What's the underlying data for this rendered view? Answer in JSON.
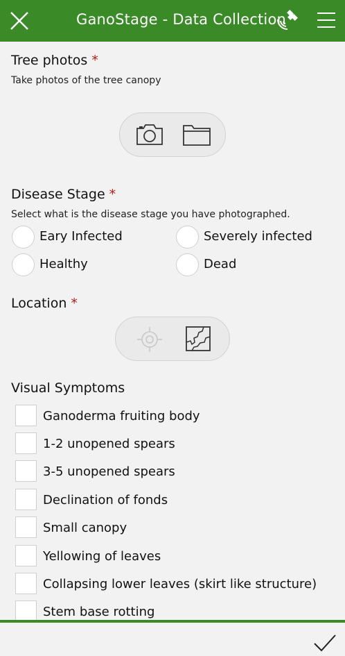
{
  "header": {
    "title": "GanoStage - Data Collection",
    "close_icon": "close-icon",
    "gps_icon": "satellite-icon",
    "menu_icon": "hamburger-menu-icon",
    "background_color": "#3a8a28"
  },
  "tree_photos": {
    "label": "Tree photos",
    "required_marker": "*",
    "hint": "Take photos of the tree canopy",
    "camera_icon": "camera-icon",
    "folder_icon": "folder-icon"
  },
  "disease_stage": {
    "label": "Disease Stage",
    "required_marker": "*",
    "hint": "Select what is the disease stage you have photographed.",
    "options": [
      {
        "label": "Eary Infected",
        "selected": false
      },
      {
        "label": "Severely infected",
        "selected": false
      },
      {
        "label": "Healthy",
        "selected": false
      },
      {
        "label": "Dead",
        "selected": false
      }
    ]
  },
  "location": {
    "label": "Location",
    "required_marker": "*",
    "gps_locate_icon": "crosshair-icon",
    "map_icon": "map-icon"
  },
  "visual_symptoms": {
    "label": "Visual Symptoms",
    "options": [
      {
        "label": "Ganoderma fruiting body",
        "checked": false
      },
      {
        "label": "1-2 unopened spears",
        "checked": false
      },
      {
        "label": "3-5 unopened spears",
        "checked": false
      },
      {
        "label": "Declination of fonds",
        "checked": false
      },
      {
        "label": "Small canopy",
        "checked": false
      },
      {
        "label": "Yellowing of leaves",
        "checked": false
      },
      {
        "label": "Collapsing lower leaves (skirt like structure)",
        "checked": false
      },
      {
        "label": "Stem base rotting",
        "checked": false
      }
    ]
  },
  "footer": {
    "submit_icon": "checkmark-icon"
  }
}
